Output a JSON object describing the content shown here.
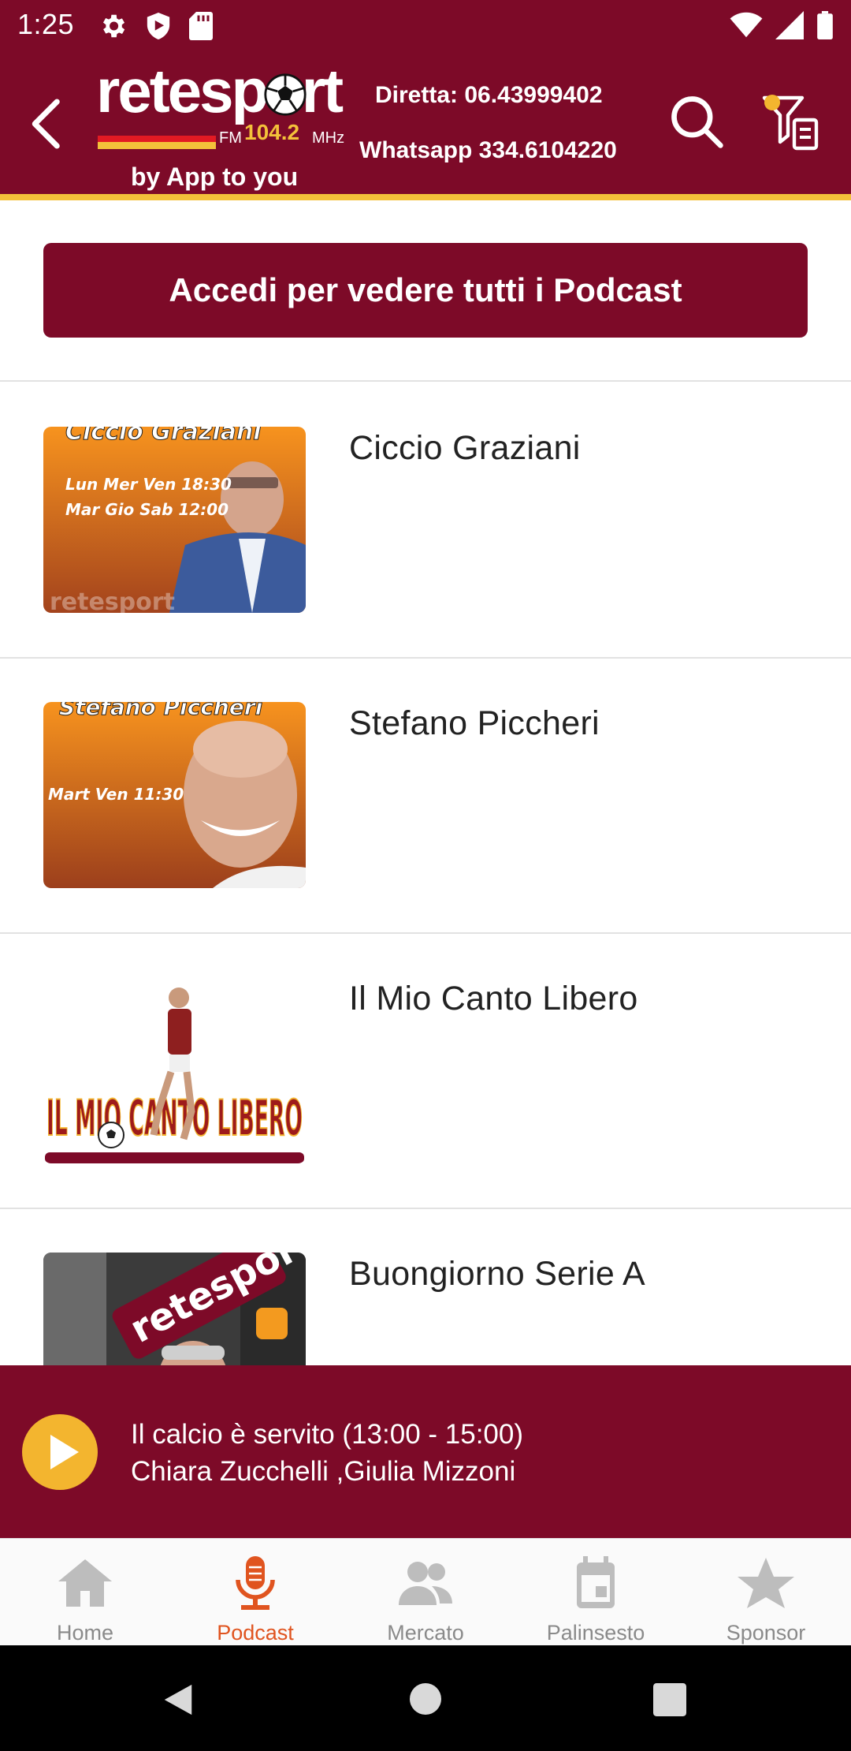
{
  "status_bar": {
    "time": "1:25",
    "left_icons": [
      "gear-icon",
      "shield-icon",
      "sd-card-icon"
    ],
    "right_icons": [
      "wifi-icon",
      "signal-icon",
      "battery-icon"
    ]
  },
  "header": {
    "logo": {
      "word": "retesport",
      "fm": "FM",
      "freq": "104.2",
      "mhz": "MHz",
      "tagline": "by App to you"
    },
    "contact_live": "Diretta: 06.43999402",
    "contact_whatsapp": "Whatsapp 334.6104220"
  },
  "cta": {
    "label": "Accedi per vedere tutti i Podcast"
  },
  "podcasts": [
    {
      "title": "Ciccio Graziani",
      "thumb_caption": "Ciccio Graziani",
      "thumb_line1": "Lun Mer Ven 18:30",
      "thumb_line2": "Mar Gio Sab 12:00",
      "thumb_brand": "retesport"
    },
    {
      "title": "Stefano Piccheri",
      "thumb_caption": "Stefano Piccheri",
      "thumb_line1": "Mart Ven 11:30"
    },
    {
      "title": "Il Mio Canto Libero",
      "thumb_caption": "IL MIO CANTO LIBERO"
    },
    {
      "title": "Buongiorno Serie A",
      "thumb_brand": "retesport"
    }
  ],
  "player": {
    "title": "Il calcio è servito (13:00 - 15:00)",
    "hosts": "Chiara Zucchelli ,Giulia Mizzoni"
  },
  "bottom_nav": [
    {
      "label": "Home",
      "icon": "home-icon"
    },
    {
      "label": "Podcast",
      "icon": "microphone-icon",
      "active": true
    },
    {
      "label": "Mercato",
      "icon": "people-icon"
    },
    {
      "label": "Palinsesto",
      "icon": "calendar-icon"
    },
    {
      "label": "Sponsor",
      "icon": "star-icon"
    }
  ],
  "colors": {
    "brand": "#7d0a28",
    "accent": "#f3c13a",
    "active_tab": "#e0541f"
  }
}
